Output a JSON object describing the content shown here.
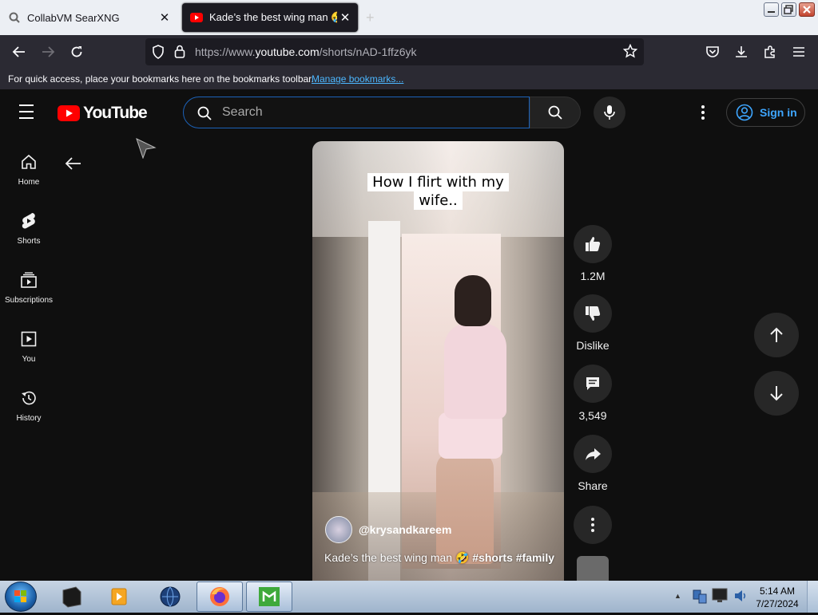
{
  "browser": {
    "tabs": [
      {
        "title": "CollabVM SearXNG",
        "active": false
      },
      {
        "title": "Kade’s the best wing man 🤣 #sh",
        "active": true
      }
    ],
    "url": {
      "prefix": "https://www.",
      "host": "youtube.com",
      "path": "/shorts/nAD-1ffz6yk"
    },
    "bookmarks_message": "For quick access, place your bookmarks here on the bookmarks toolbar.",
    "bookmarks_link": "Manage bookmarks..."
  },
  "youtube": {
    "logo_text": "YouTube",
    "search_placeholder": "Search",
    "sign_in_label": "Sign in",
    "sidebar": [
      {
        "label": "Home",
        "icon": "home-icon"
      },
      {
        "label": "Shorts",
        "icon": "shorts-icon"
      },
      {
        "label": "Subscriptions",
        "icon": "subscriptions-icon"
      },
      {
        "label": "You",
        "icon": "you-icon"
      },
      {
        "label": "History",
        "icon": "history-icon"
      }
    ],
    "video": {
      "caption_line1": "How I flirt with my",
      "caption_line2": "wife..",
      "channel": "@krysandkareem",
      "title_text": "Kade’s the best wing man 🤣",
      "title_tags": "#shorts #family"
    },
    "actions": {
      "likes": "1.2M",
      "dislike_label": "Dislike",
      "comments": "3,549",
      "share_label": "Share"
    }
  },
  "taskbar": {
    "time": "5:14 AM",
    "date": "7/27/2024"
  },
  "colors": {
    "yt_red": "#ff0000",
    "sign_in_blue": "#3ea6ff",
    "search_focus_border": "#1c62b9",
    "bookmark_link": "#4cb7ff"
  }
}
